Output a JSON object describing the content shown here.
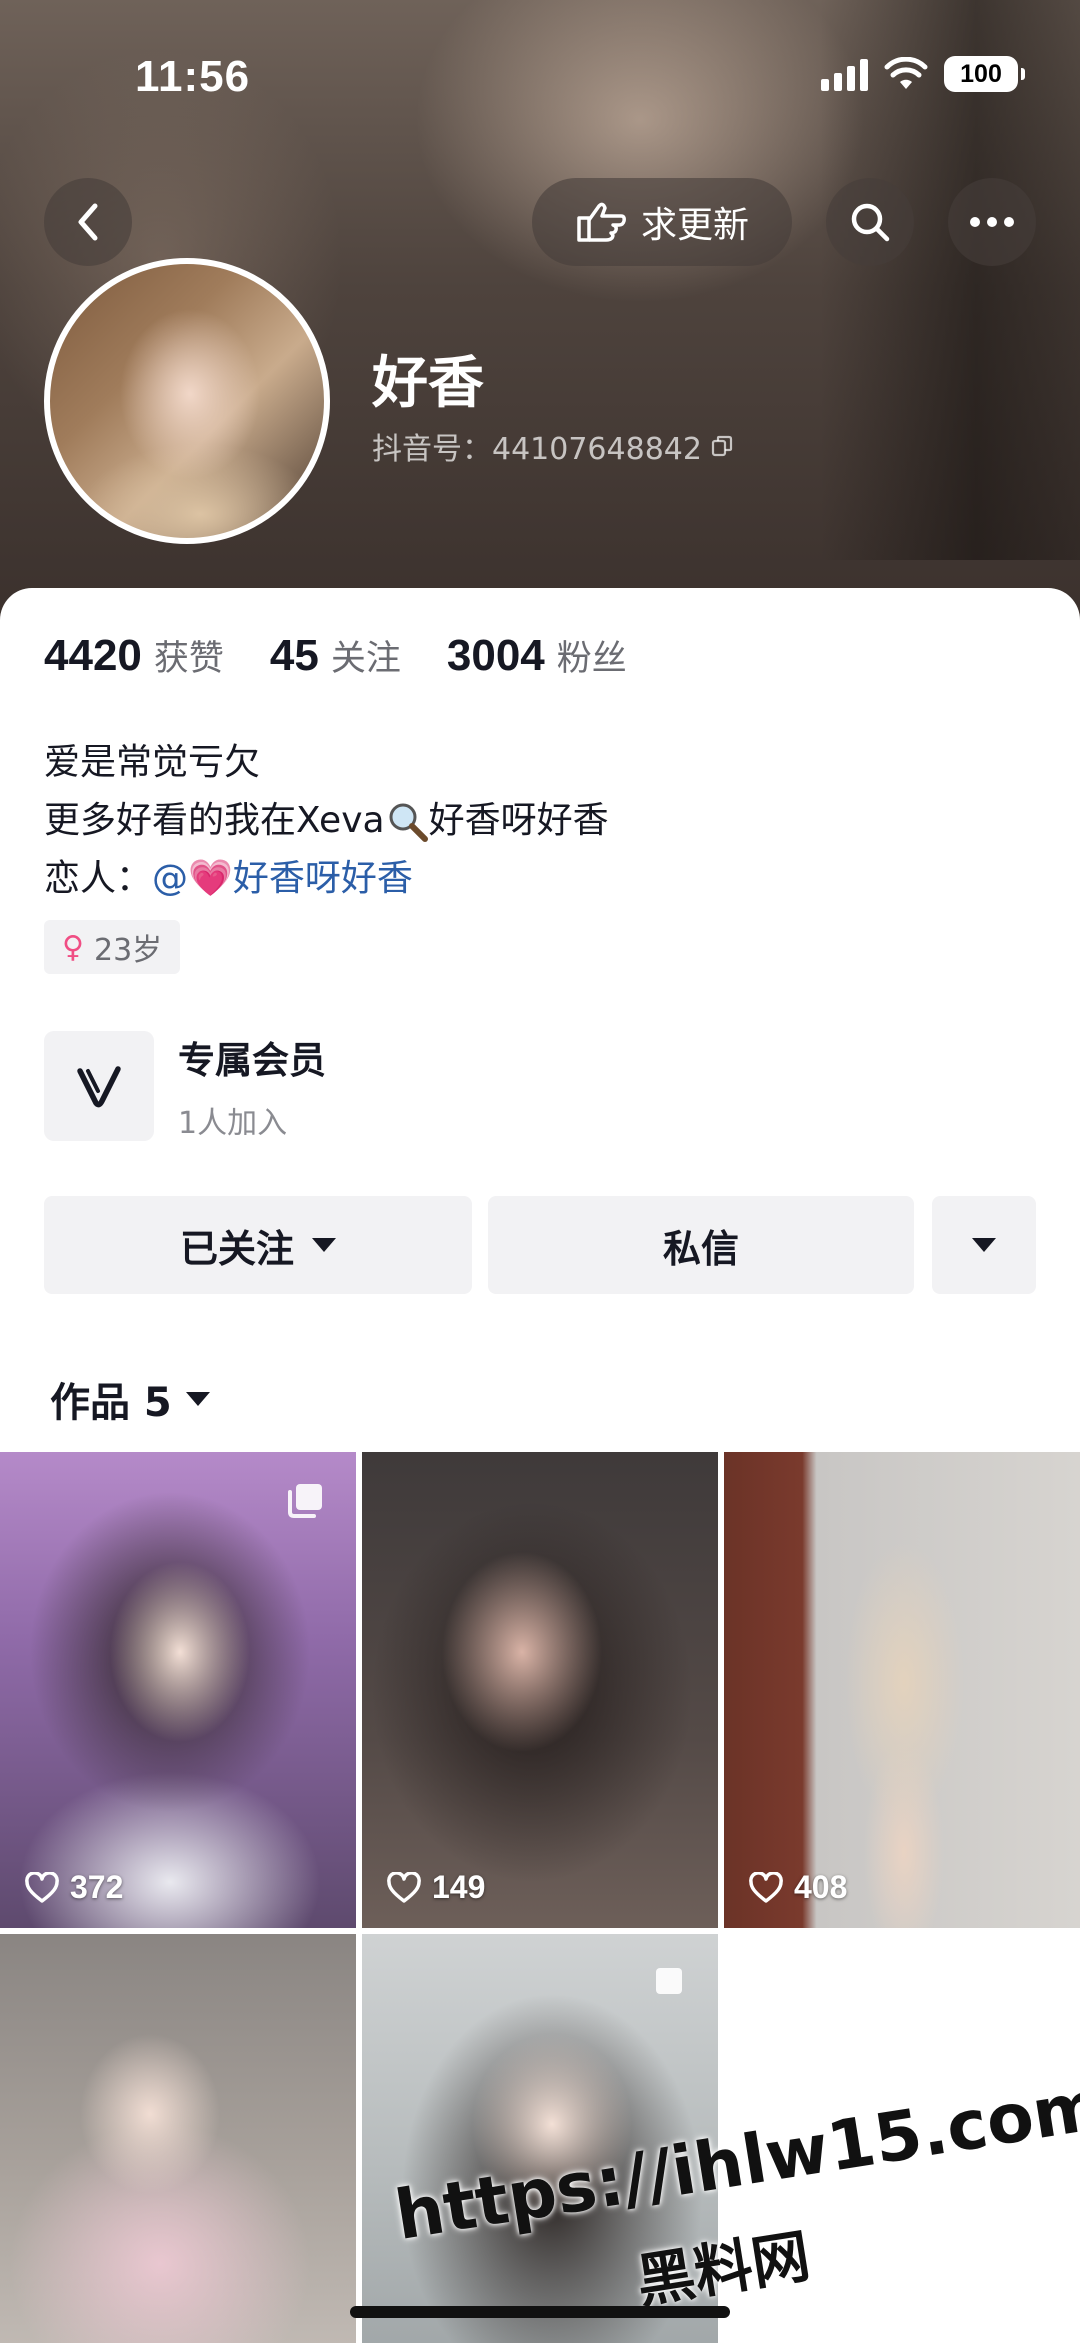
{
  "status_bar": {
    "time": "11:56",
    "battery": "100"
  },
  "nav": {
    "update_label": "求更新"
  },
  "profile": {
    "name": "好香",
    "douyin_id": "抖音号：44107648842"
  },
  "stats": [
    {
      "value": "4420",
      "label": "获赞"
    },
    {
      "value": "45",
      "label": "关注"
    },
    {
      "value": "3004",
      "label": "粉丝"
    }
  ],
  "bio": {
    "line1": "爱是常觉亏欠",
    "line2_prefix": "更多好看的我在Xeva",
    "line2_suffix": "好香呀好香",
    "line3_prefix": "恋人：",
    "line3_mention": "@💗好香呀好香"
  },
  "age_tag": "23岁",
  "membership": {
    "title": "专属会员",
    "subtitle": "1人加入"
  },
  "actions": {
    "follow": "已关注",
    "message": "私信"
  },
  "works": {
    "label": "作品 5"
  },
  "videos": [
    {
      "likes": "372"
    },
    {
      "likes": "149"
    },
    {
      "likes": "408"
    },
    {
      "likes": ""
    },
    {
      "likes": ""
    }
  ],
  "watermark": {
    "url": "https://ihlw15.com",
    "name": "黑料网"
  },
  "colors": {
    "accent_link": "#2b5ea8",
    "female": "#f04e84",
    "button_bg": "#f2f2f4"
  }
}
